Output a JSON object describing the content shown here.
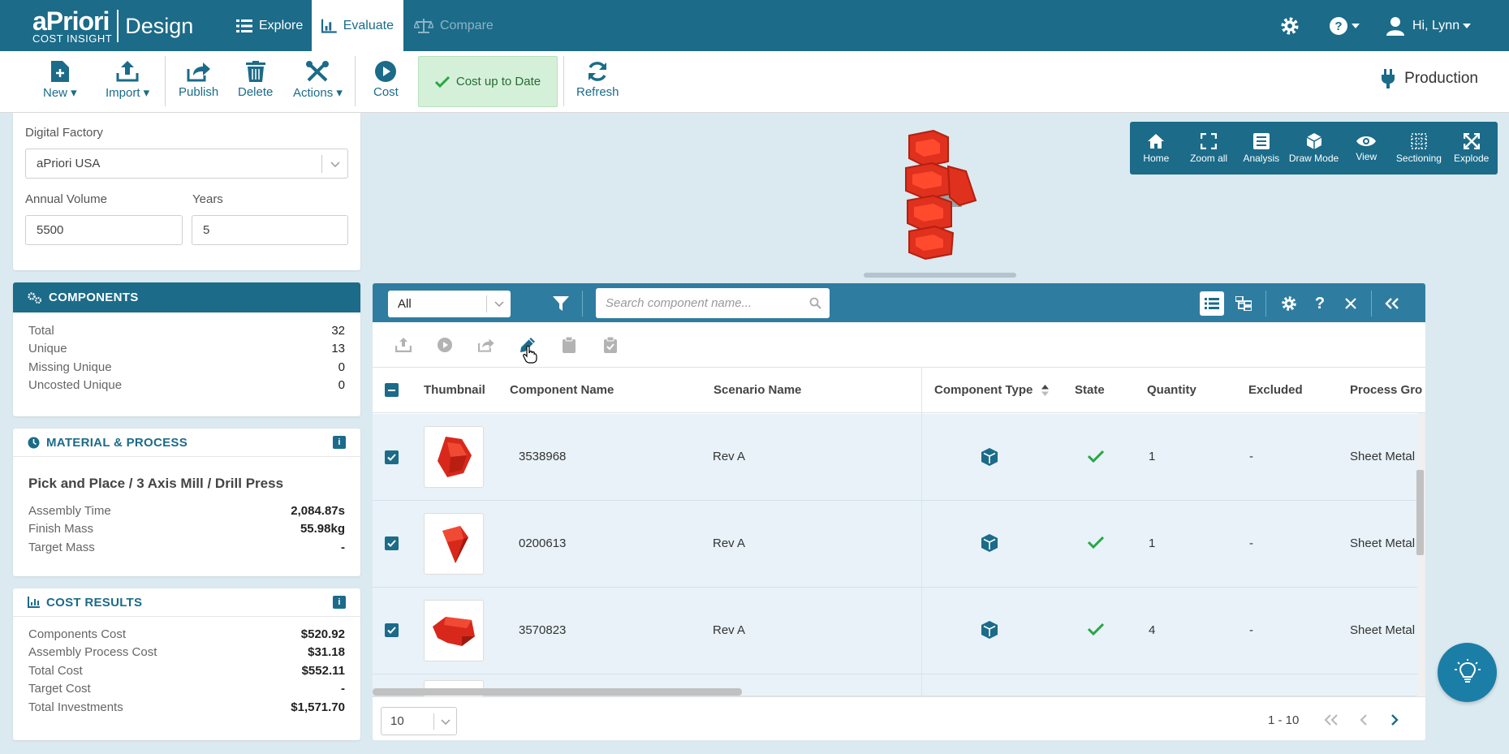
{
  "brand": {
    "name": "aPriori",
    "sub": "COST INSIGHT",
    "product": "Design"
  },
  "nav": {
    "tabs": [
      {
        "label": "Explore",
        "icon": "list-icon"
      },
      {
        "label": "Evaluate",
        "icon": "chart-icon"
      },
      {
        "label": "Compare",
        "icon": "scale-icon"
      }
    ],
    "greeting": "Hi, Lynn"
  },
  "toolbar": {
    "new_label": "New",
    "import_label": "Import",
    "publish_label": "Publish",
    "delete_label": "Delete",
    "actions_label": "Actions",
    "cost_label": "Cost",
    "status_label": "Cost up to Date",
    "refresh_label": "Refresh",
    "deployment": "Production"
  },
  "inputs": {
    "digital_factory_label": "Digital Factory",
    "digital_factory_value": "aPriori USA",
    "annual_volume_label": "Annual Volume",
    "annual_volume_value": "5500",
    "years_label": "Years",
    "years_value": "5"
  },
  "components_panel": {
    "title": "COMPONENTS",
    "rows": [
      {
        "label": "Total",
        "value": "32"
      },
      {
        "label": "Unique",
        "value": "13"
      },
      {
        "label": "Missing Unique",
        "value": "0"
      },
      {
        "label": "Uncosted Unique",
        "value": "0"
      }
    ]
  },
  "material_panel": {
    "title": "MATERIAL & PROCESS",
    "process": "Pick and Place / 3 Axis Mill / Drill Press",
    "rows": [
      {
        "label": "Assembly Time",
        "value": "2,084.87s"
      },
      {
        "label": "Finish Mass",
        "value": "55.98kg"
      },
      {
        "label": "Target Mass",
        "value": "-"
      }
    ]
  },
  "cost_panel": {
    "title": "COST RESULTS",
    "rows": [
      {
        "label": "Components Cost",
        "value": "$520.92"
      },
      {
        "label": "Assembly Process Cost",
        "value": "$31.18"
      },
      {
        "label": "Total Cost",
        "value": "$552.11"
      },
      {
        "label": "Target Cost",
        "value": "-"
      },
      {
        "label": "Total Investments",
        "value": "$1,571.70"
      }
    ]
  },
  "viewer_tools": [
    "Home",
    "Zoom all",
    "Analysis",
    "Draw Mode",
    "View",
    "Sectioning",
    "Explode"
  ],
  "grid": {
    "filter_value": "All",
    "search_placeholder": "Search component name...",
    "columns": [
      "Thumbnail",
      "Component Name",
      "Scenario Name",
      "Component Type",
      "State",
      "Quantity",
      "Excluded",
      "Process Gro"
    ],
    "rows": [
      {
        "component": "3538968",
        "scenario": "Rev A",
        "quantity": "1",
        "excluded": "-",
        "process": "Sheet Metal"
      },
      {
        "component": "0200613",
        "scenario": "Rev A",
        "quantity": "1",
        "excluded": "-",
        "process": "Sheet Metal"
      },
      {
        "component": "3570823",
        "scenario": "Rev A",
        "quantity": "4",
        "excluded": "-",
        "process": "Sheet Metal"
      }
    ],
    "page_size": "10",
    "range": "1 - 10"
  },
  "colors": {
    "primary": "#1b6b89",
    "status_bg": "#d5f0d9",
    "part_red": "#e0301e",
    "check_green": "#28a745"
  }
}
